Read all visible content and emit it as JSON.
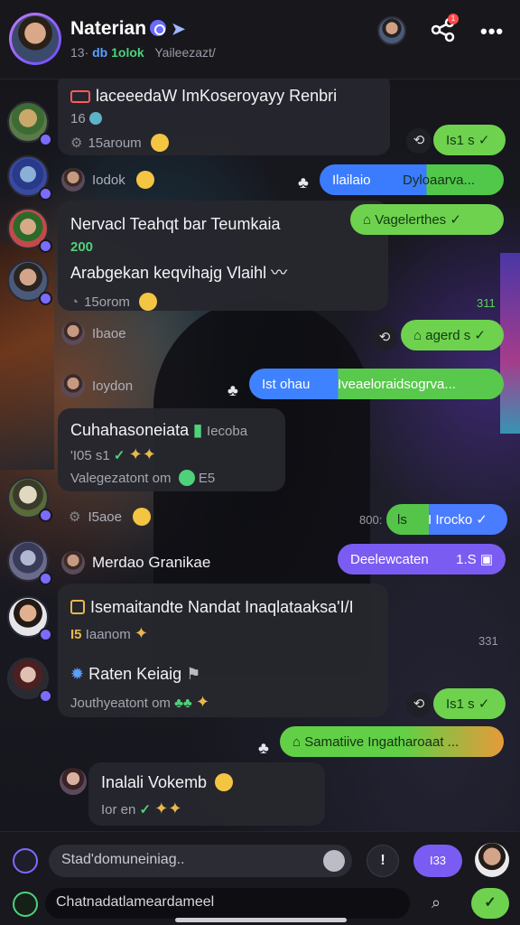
{
  "header": {
    "name": "Naterian",
    "sub_prefix": "13·",
    "sub_tag1": "db",
    "sub_tag2": "1olok",
    "sub_rest": "Yaileezazt/",
    "badge_count": "1"
  },
  "messages": {
    "m1_title": "laceeedaW ImKoseroyayy Renbri",
    "m1_sub": "16",
    "m1_meta": "15aroum",
    "m1_pill": "Is1 s ✓",
    "m2_meta": "Iodok",
    "m2_pill_left": "Ilailaio",
    "m2_pill_right": "Dyloaarva...",
    "m3_title": "Nervacl Teahqt bar Teumkaia",
    "m3_sub": "200",
    "m3_pill": "Vagelerthes ✓",
    "m3_title2": "Arabgekan keqvihajg Vlaihl",
    "m3_meta": "15orom",
    "m3_side": "311",
    "m4_meta": "Ibaoe",
    "m4_pill": "agerd s ✓",
    "m5_meta": "Ioydon",
    "m5_pill_left": "Ist ohau",
    "m5_pill_right": "Iveaeloraidsogrva...",
    "m6_title": "Cuhahasoneiata",
    "m6_title_tag": "Iecoba",
    "m6_sub": "'I05 s1",
    "m6_meta": "Valegezatont om",
    "m6_meta_num": "E5",
    "m7_meta": "I5aoe",
    "m7_side": "800:",
    "m7_pill_left": "ls",
    "m7_pill_right": "I Irocko ✓",
    "m8_name": "Merdao Granikae",
    "m8_pill": "Deelewcaten",
    "m8_pill_num": "1.S",
    "m9_title": "Isemaitandte Nandat Inaqlataaksa'I/I",
    "m9_sub_num": "I5",
    "m9_sub": "Iaanom",
    "m9_side": "331",
    "m9_name": "Raten Keiaig",
    "m9_meta": "Jouthyeatont om",
    "m9_pill": "Is1 s ✓",
    "m10_pill": "Samatiive Ingatharoaat ...",
    "m11_title": "Inalali Vokemb",
    "m11_meta": "Ior en"
  },
  "composer": {
    "input_placeholder": "Stad'domuneiniag..",
    "button_label": "I33",
    "input2_value": "Chatnadatlameardameel"
  }
}
